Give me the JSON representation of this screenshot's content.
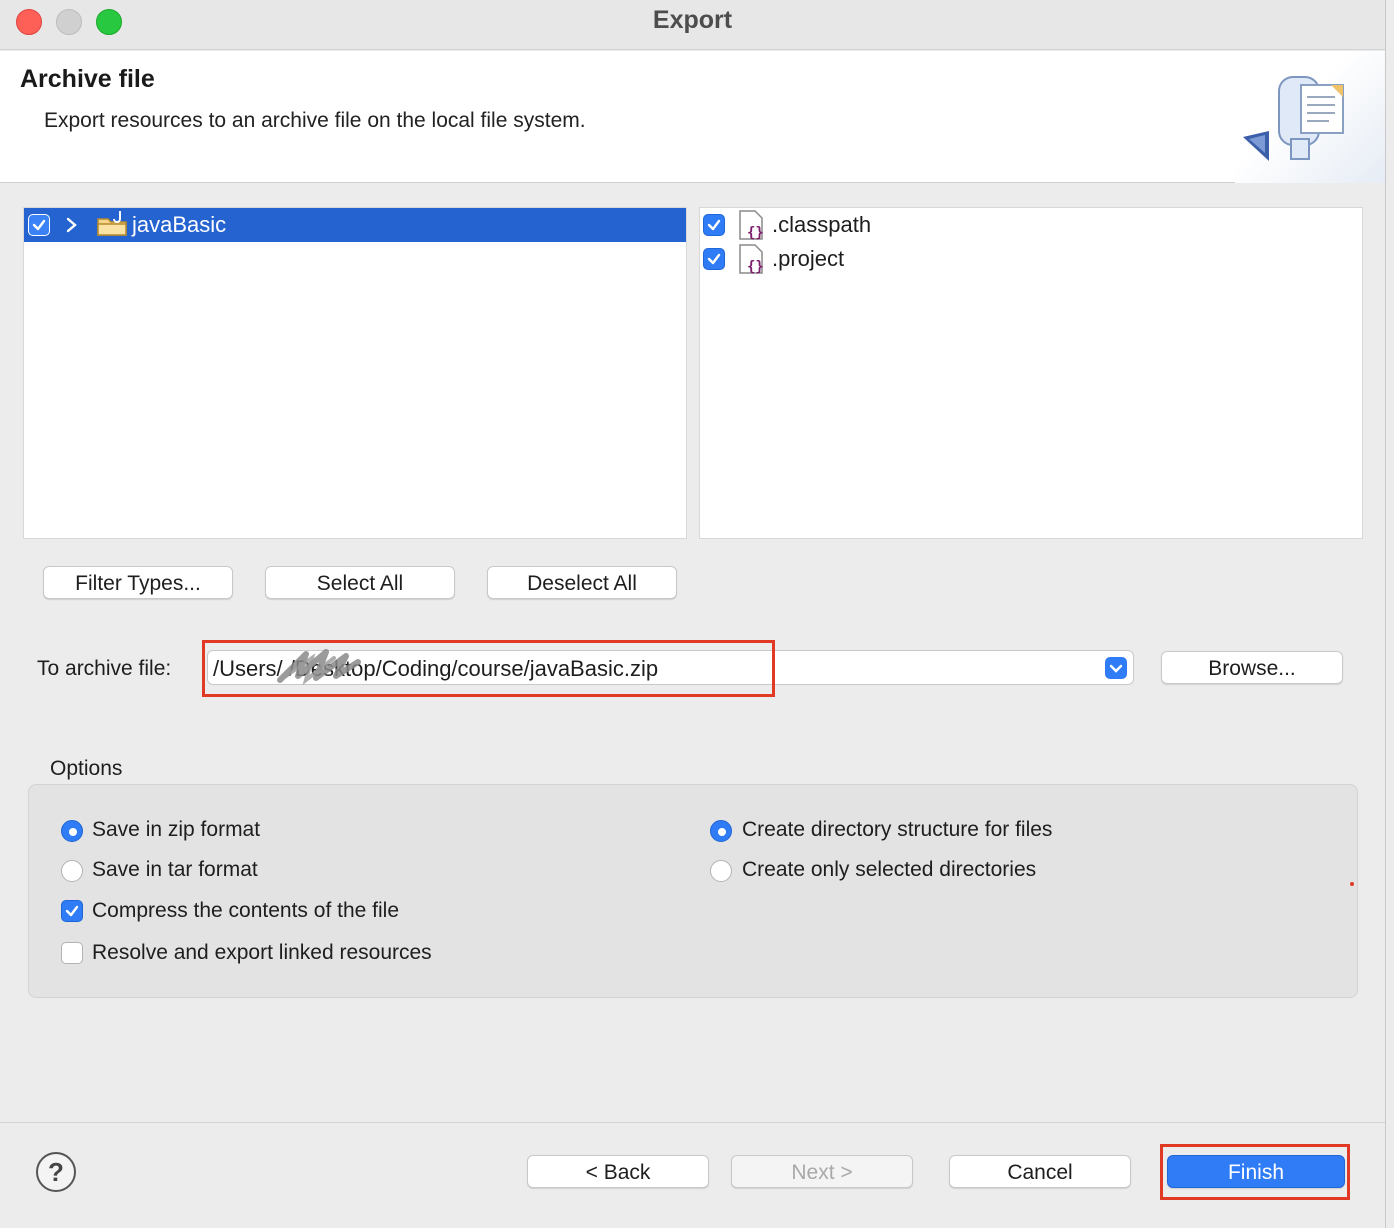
{
  "window": {
    "title": "Export"
  },
  "banner": {
    "title": "Archive file",
    "description": "Export resources to an archive file on the local file system."
  },
  "left_tree": {
    "items": [
      {
        "label": "javaBasic",
        "checked": true,
        "expanded": false,
        "selected": true
      }
    ]
  },
  "right_list": {
    "items": [
      {
        "label": ".classpath",
        "checked": true
      },
      {
        "label": ".project",
        "checked": true
      }
    ]
  },
  "selection_buttons": {
    "filter_types": "Filter Types...",
    "select_all": "Select All",
    "deselect_all": "Deselect All"
  },
  "archive": {
    "label": "To archive file:",
    "path": "/Users/        /Desktop/Coding/course/javaBasic.zip",
    "browse": "Browse..."
  },
  "options": {
    "label": "Options",
    "save_zip": "Save in zip format",
    "save_tar": "Save in tar format",
    "compress": "Compress the contents of the file",
    "resolve_linked": "Resolve and export linked resources",
    "create_dir_structure": "Create directory structure for files",
    "create_selected_dirs": "Create only selected directories",
    "state": {
      "format": "zip",
      "compress": true,
      "resolve_linked": false,
      "structure": "directory"
    }
  },
  "footer": {
    "help": "?",
    "back": "< Back",
    "next": "Next >",
    "cancel": "Cancel",
    "finish": "Finish"
  },
  "colors": {
    "accent": "#2f7cf6",
    "selection": "#2563d0",
    "highlight_box": "#e03a24"
  }
}
